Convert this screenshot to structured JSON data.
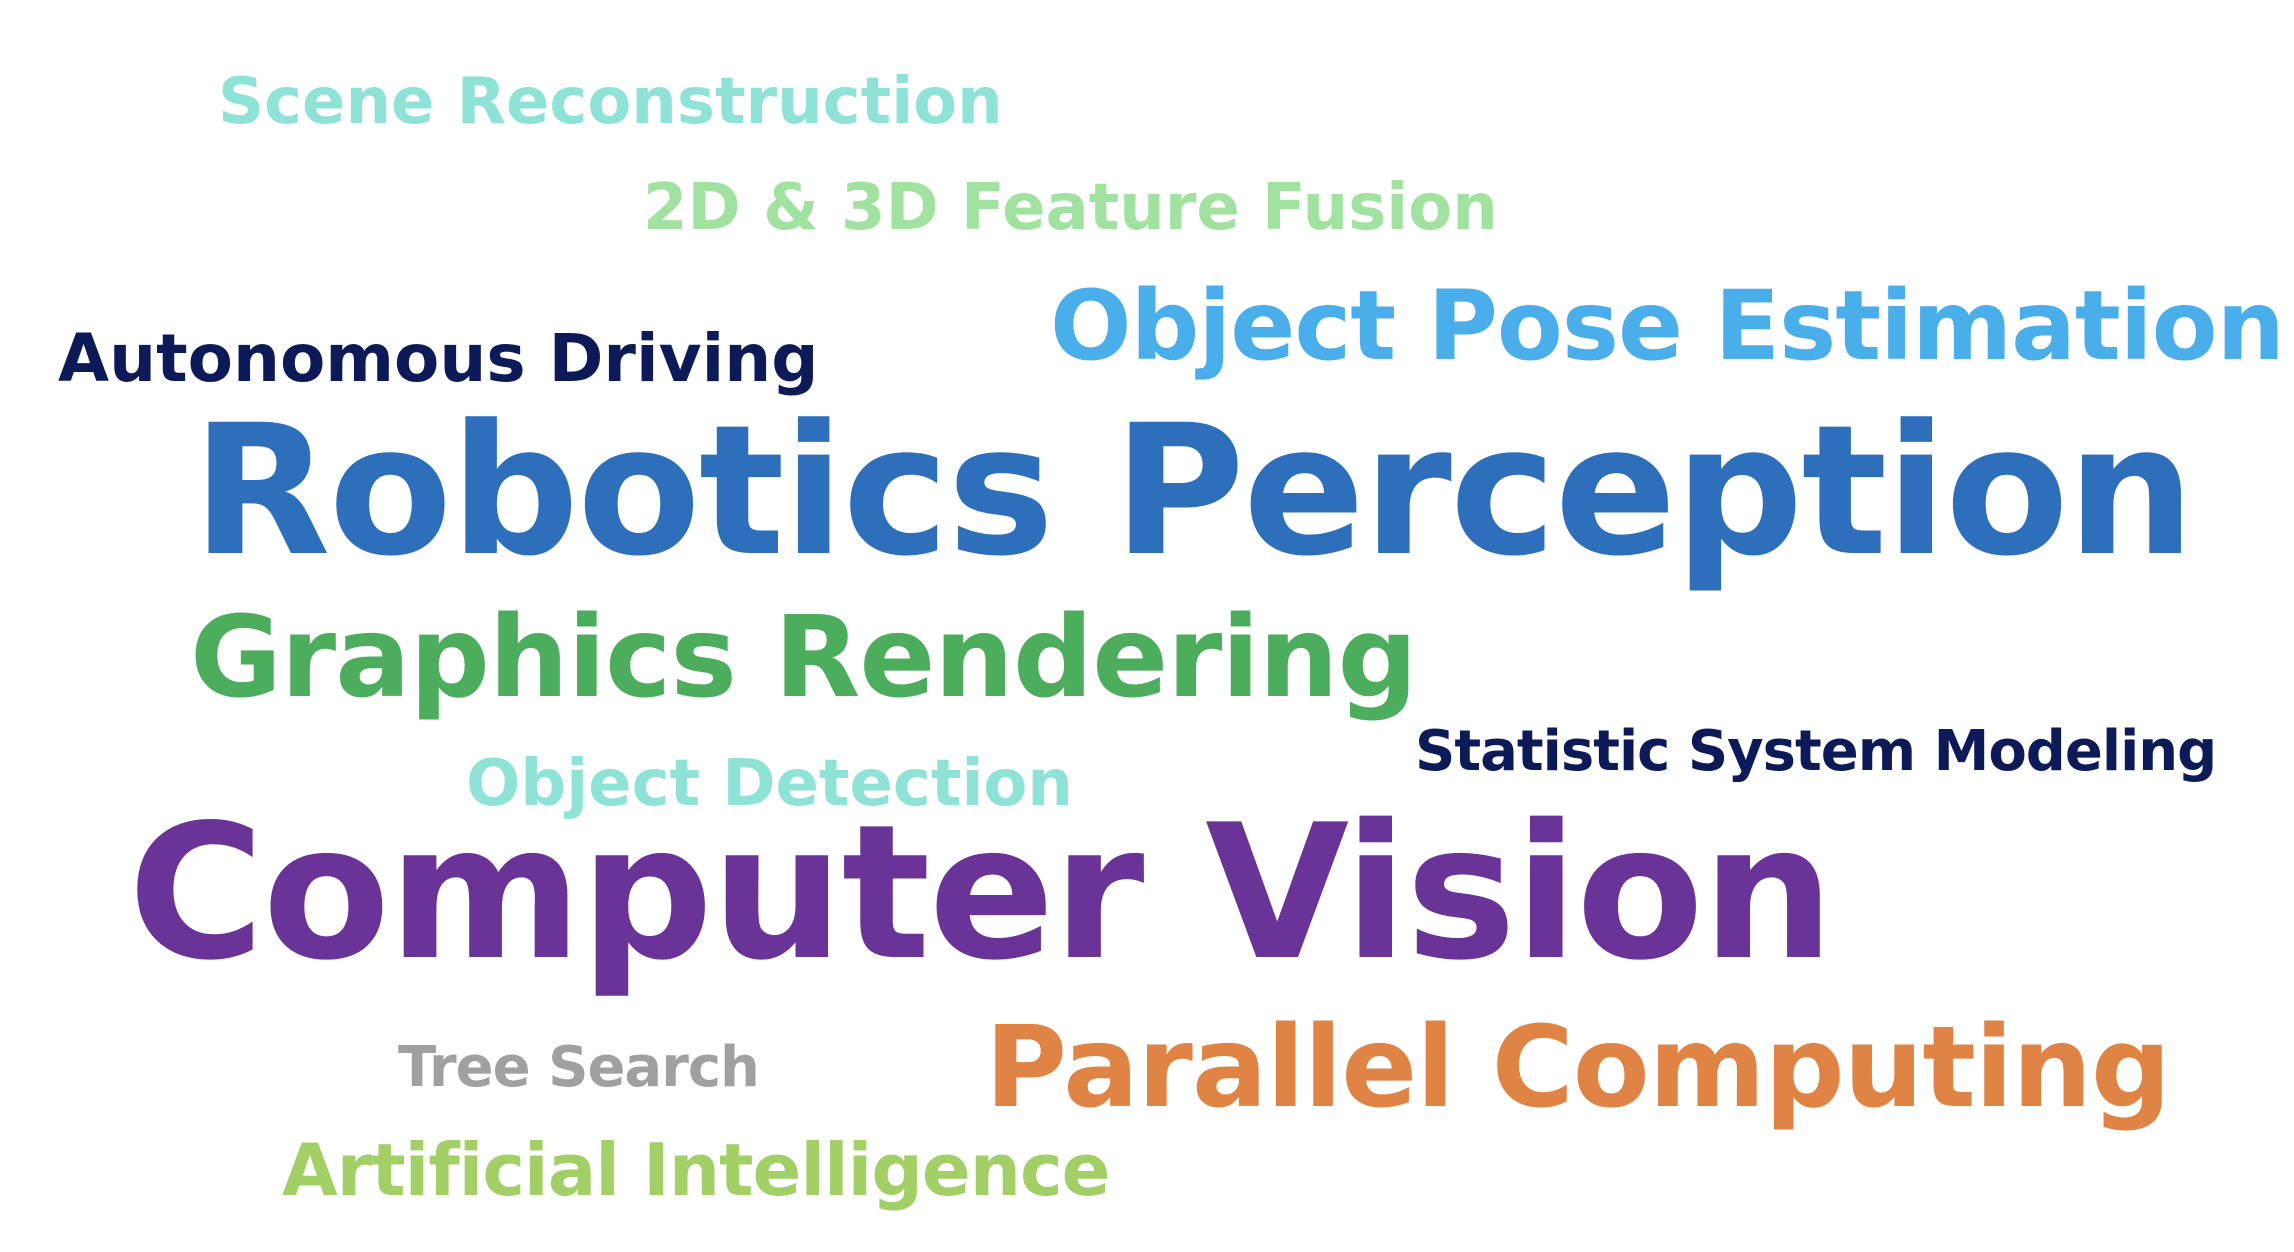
{
  "words": {
    "scene_reconstruction": {
      "text": "Scene Reconstruction",
      "color": "#8ee3d6"
    },
    "feature_fusion": {
      "text": "2D & 3D Feature Fusion",
      "color": "#a2e2a0"
    },
    "object_pose_estimation": {
      "text": "Object Pose Estimation",
      "color": "#49aeea"
    },
    "autonomous_driving": {
      "text": "Autonomous Driving",
      "color": "#0d1a58"
    },
    "robotics_perception": {
      "text": "Robotics Perception",
      "color": "#2d6fba"
    },
    "graphics_rendering": {
      "text": "Graphics Rendering",
      "color": "#4cad5d"
    },
    "statistic_system_modeling": {
      "text": "Statistic System Modeling",
      "color": "#0d1a58"
    },
    "object_detection": {
      "text": "Object Detection",
      "color": "#8ee3d6"
    },
    "computer_vision": {
      "text": "Computer Vision",
      "color": "#6a3397"
    },
    "tree_search": {
      "text": "Tree Search",
      "color": "#a0a0a0"
    },
    "parallel_computing": {
      "text": "Parallel Computing",
      "color": "#e08445"
    },
    "artificial_intelligence": {
      "text": "Artificial Intelligence",
      "color": "#a2cf66"
    }
  }
}
